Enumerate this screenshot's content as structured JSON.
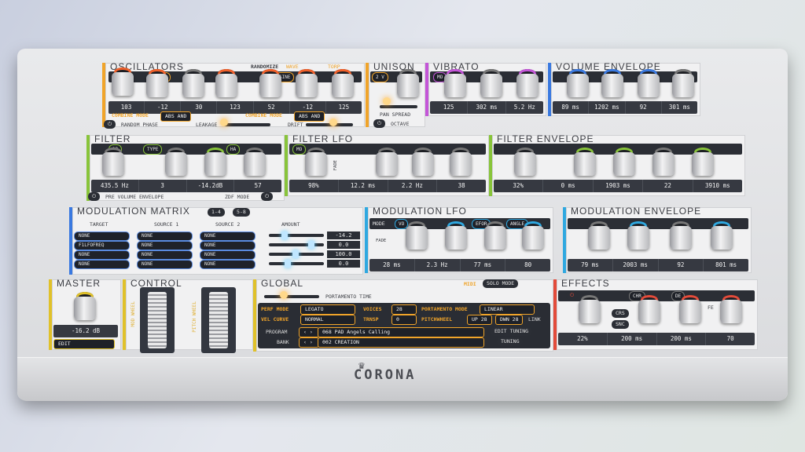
{
  "brand": "CORONA",
  "colors": {
    "orange": "#f0a42a",
    "vibrato": "#c455d8",
    "blue": "#3a79e0",
    "green": "#88c43a",
    "cyan": "#2fa8e0",
    "yellow": "#e0c12a",
    "red": "#e34b3a"
  },
  "oscillators": {
    "title": "OSCILLATORS",
    "randomize": "RANDOMIZE",
    "wave": "WAVE",
    "torp": "TORP",
    "pill_1": "ARE",
    "pill_2": "SINE",
    "readouts": [
      "103",
      "-12",
      "30",
      "123",
      "52",
      "-12",
      "125"
    ],
    "combine_label": "COMBINE MODE",
    "combine_value": "ABS AND",
    "combine_label_2": "COMBINE MODE",
    "combine_value_2": "ABS AND",
    "random_phase": "RANDOM PHASE",
    "leakage": "LEAKAGE",
    "drift": "DRIFT"
  },
  "unison": {
    "title": "UNISON",
    "pan_spread": "PAN SPREAD",
    "octave": "OCTAVE",
    "pill": "2 V"
  },
  "vibrato": {
    "title": "VIBRATO",
    "pill": "MO",
    "readouts": [
      "125",
      "302 ms",
      "5.2 Hz"
    ]
  },
  "volume_envelope": {
    "title": "VOLUME ENVELOPE",
    "readouts": [
      "89 ms",
      "1202 ms",
      "92",
      "301 ms"
    ]
  },
  "filter": {
    "title": "FILTER",
    "pill_1": "12",
    "pill_2": "TYPE",
    "pill_3": "HA",
    "readouts": [
      "435.5 Hz",
      "3",
      "-14.2dB",
      "57"
    ],
    "pre_volume": "PRE VOLUME ENVELOPE",
    "zdf": "ZDF MODE"
  },
  "filter_lfo": {
    "title": "FILTER LFO",
    "pill": "MO",
    "fade": "FADE",
    "readouts": [
      "98%",
      "12.2 ms",
      "2.2 Hz",
      "38"
    ]
  },
  "filter_envelope": {
    "title": "FILTER ENVELOPE",
    "readouts": [
      "32%",
      "0 ms",
      "1903 ms",
      "22",
      "3910 ms"
    ]
  },
  "mod_matrix": {
    "title": "MODULATION MATRIX",
    "page_1": "1-4",
    "page_2": "5-8",
    "col_target": "TARGET",
    "col_source1": "SOURCE 1",
    "col_source2": "SOURCE 2",
    "col_amount": "AMOUNT",
    "rows": [
      {
        "target": "NONE",
        "source1": "NONE",
        "source2": "NONE",
        "value": "-14.2"
      },
      {
        "target": "F1LFOFREQ",
        "source1": "NONE",
        "source2": "NONE",
        "value": "0.0"
      },
      {
        "target": "NONE",
        "source1": "NONE",
        "source2": "NONE",
        "value": "100.0"
      },
      {
        "target": "NONE",
        "source1": "NONE",
        "source2": "NONE",
        "value": "0.0"
      }
    ]
  },
  "mod_lfo": {
    "title": "MODULATION LFO",
    "mode": "MODE",
    "pill": "VO",
    "pill_2": "EFOR",
    "pill_3": "ANGLE",
    "fade": "FADE",
    "readouts": [
      "28 ms",
      "2.3 Hz",
      "77 ms",
      "80"
    ]
  },
  "mod_envelope": {
    "title": "MODULATION ENVELOPE",
    "readouts": [
      "79 ms",
      "2003 ms",
      "92",
      "801 ms"
    ]
  },
  "master": {
    "title": "MASTER",
    "value": "-16.2 dB",
    "edit": "EDIT"
  },
  "control": {
    "title": "CONTROL",
    "mod_wheel": "MOD WHEEL",
    "pitch_wheel": "PITCH WHEEL"
  },
  "global": {
    "title": "GLOBAL",
    "midi": "MIDI",
    "solo_mode": "SOLO MODE",
    "portamento_time": "PORTAMENTO TIME",
    "perf_mode_label": "PERF MODE",
    "perf_mode": "LEGATO",
    "voices_label": "VOICES",
    "voices": "28",
    "portamento_mode_label": "PORTAMENTO MODE",
    "portamento_mode": "LINEAR",
    "vel_curve_label": "VEL CURVE",
    "vel_curve": "NORMAL",
    "transp_label": "TRNSP",
    "transp": "0",
    "pitchwheel_label": "PITCHWHEEL",
    "up": "UP 28",
    "down": "DWN 28",
    "link": "LINK",
    "program_label": "PROGRAM",
    "program": "068 PAD Angels Calling",
    "bank_label": "BANK",
    "bank": "002 CREATION",
    "edit_tuning": "EDIT TUNING",
    "tuning": "TUNING"
  },
  "effects": {
    "title": "EFFECTS",
    "pill_1": "CHR",
    "pill_2": "DE",
    "crs": "CRS",
    "snc": "SNC",
    "fe": "FE",
    "readouts": [
      "22%",
      "200 ms",
      "200 ms",
      "70"
    ]
  }
}
